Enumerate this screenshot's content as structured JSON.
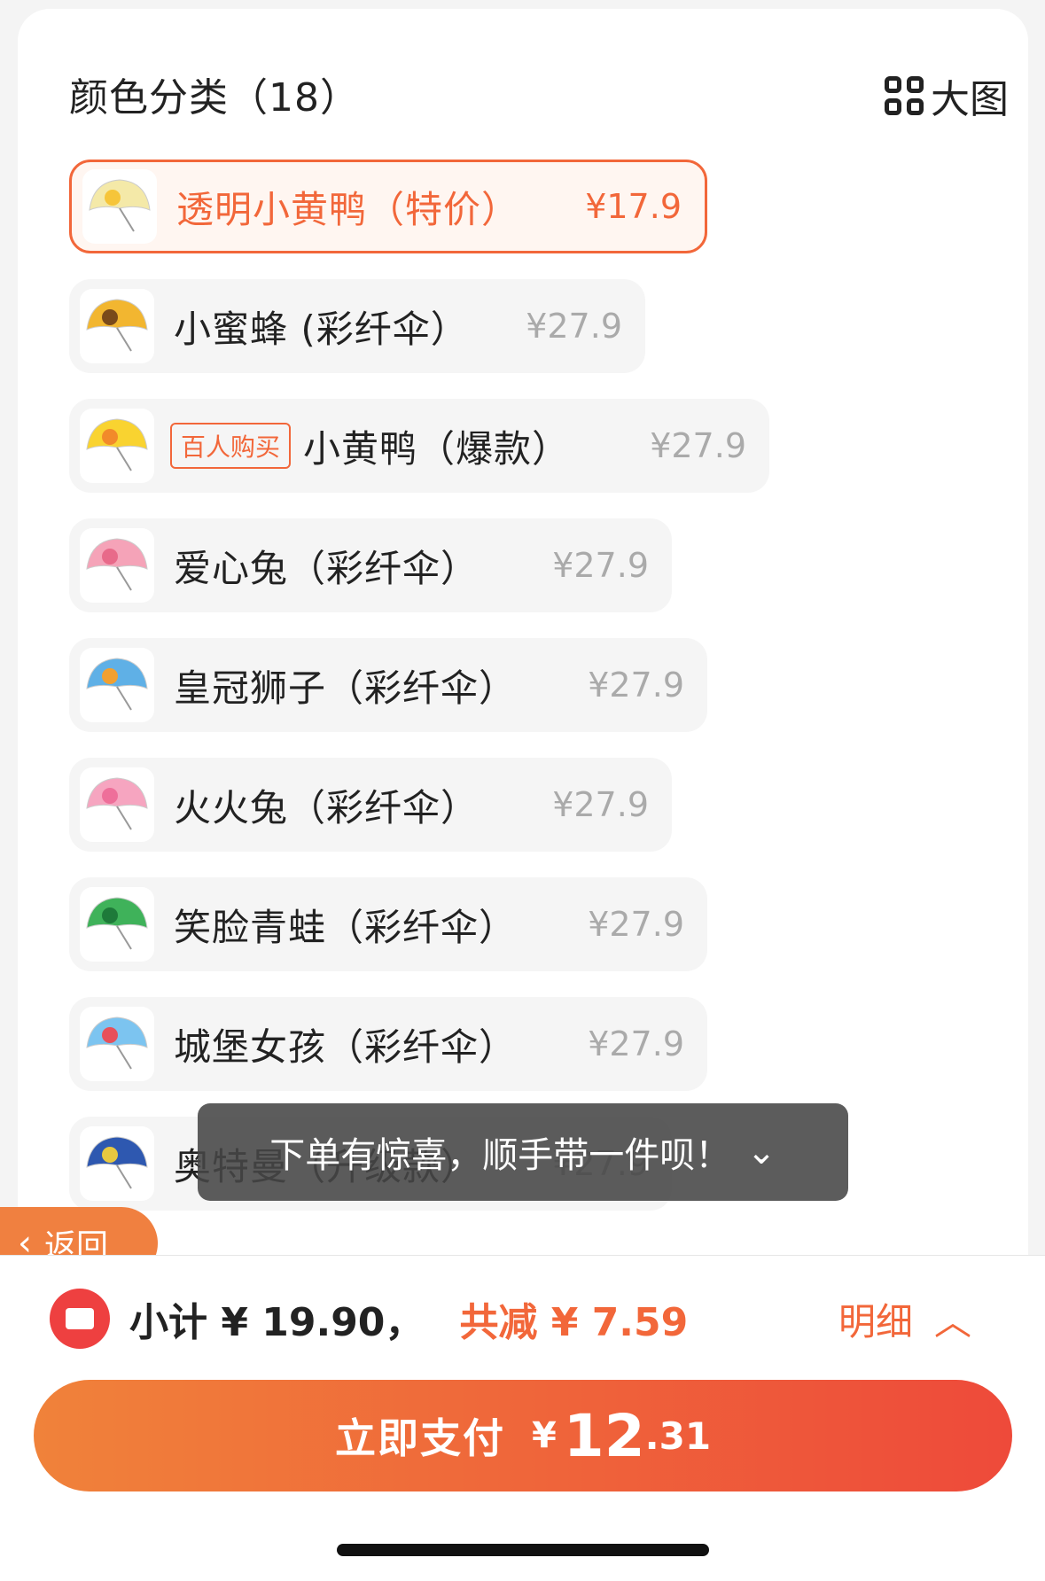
{
  "header": {
    "title": "颜色分类（18）",
    "big_view_label": "大图"
  },
  "items": [
    {
      "name": "透明小黄鸭（特价）",
      "price": "¥17.9",
      "tag": "",
      "selected": true,
      "colors": [
        "#f4e9a8",
        "#f6c53a"
      ]
    },
    {
      "name": "小蜜蜂 (彩纤伞）",
      "price": "¥27.9",
      "tag": "",
      "selected": false,
      "colors": [
        "#f2b630",
        "#7a4a1a"
      ]
    },
    {
      "name": "小黄鸭（爆款）",
      "price": "¥27.9",
      "tag": "百人购买",
      "selected": false,
      "colors": [
        "#f9d330",
        "#f28a2a"
      ]
    },
    {
      "name": "爱心兔（彩纤伞）",
      "price": "¥27.9",
      "tag": "",
      "selected": false,
      "colors": [
        "#f5a3b8",
        "#e86a8a"
      ]
    },
    {
      "name": "皇冠狮子（彩纤伞）",
      "price": "¥27.9",
      "tag": "",
      "selected": false,
      "colors": [
        "#5fb0e6",
        "#f2a030"
      ]
    },
    {
      "name": "火火兔（彩纤伞）",
      "price": "¥27.9",
      "tag": "",
      "selected": false,
      "colors": [
        "#f6a5c0",
        "#ee6f9a"
      ]
    },
    {
      "name": "笑脸青蛙（彩纤伞）",
      "price": "¥27.9",
      "tag": "",
      "selected": false,
      "colors": [
        "#3fb25a",
        "#1e7a3a"
      ]
    },
    {
      "name": "城堡女孩（彩纤伞）",
      "price": "¥27.9",
      "tag": "",
      "selected": false,
      "colors": [
        "#7cc4f0",
        "#e8505a"
      ]
    },
    {
      "name": "奥特曼（升级款）",
      "price": "¥27.9",
      "tag": "",
      "selected": false,
      "colors": [
        "#2e58b0",
        "#e8c840"
      ]
    }
  ],
  "toast": {
    "text": "下单有惊喜，顺手带一件呗！",
    "icon": "double-chevron-down-icon"
  },
  "back": {
    "label": "返回"
  },
  "summary": {
    "subtotal": "小计 ¥ 19.90，",
    "discount": "共减 ¥ 7.59",
    "detail_label": "明细"
  },
  "pay": {
    "label": "立即支付",
    "currency": "¥",
    "amount_int": "12",
    "amount_dec": ".31"
  },
  "colors": {
    "accent": "#f2673a",
    "gradient_start": "#f0823a",
    "gradient_end": "#ee4a3a"
  }
}
